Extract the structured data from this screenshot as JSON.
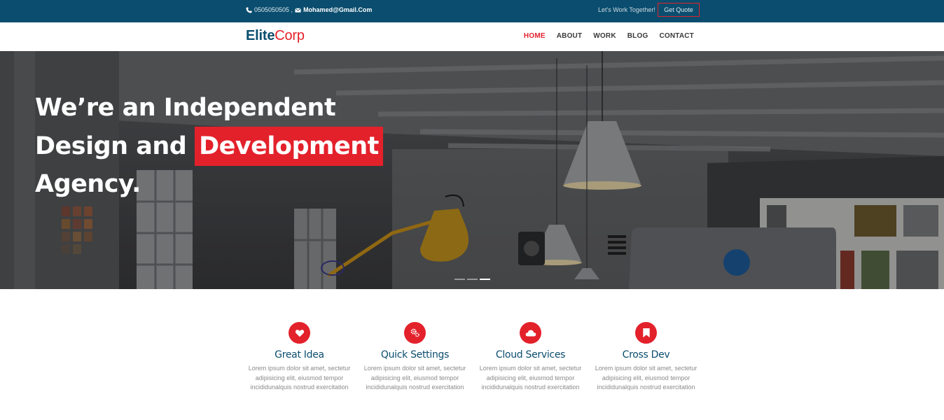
{
  "topbar": {
    "phone": "0505050505 ,",
    "email": "Mohamed@Gmail.Com",
    "tagline": "Let's Work Together!",
    "quote_label": "Get Quote"
  },
  "logo": {
    "part1": "Elite",
    "part2": "Corp"
  },
  "nav": {
    "items": [
      "HOME",
      "ABOUT",
      "WORK",
      "BLOG",
      "CONTACT"
    ],
    "active": "HOME"
  },
  "hero": {
    "line1": "We’re an Independent",
    "line2_pre": "Design and",
    "line2_highlight": "Development",
    "line3": "Agency.",
    "slides": 3,
    "active_slide": 3
  },
  "features": [
    {
      "icon": "heart-icon",
      "title": "Great Idea",
      "text": "Lorem ipsum dolor sit amet, sectetur adipisicing elit, eiusmod tempor incididunalquis nostrud exercitation"
    },
    {
      "icon": "gears-icon",
      "title": "Quick Settings",
      "text": "Lorem ipsum dolor sit amet, sectetur adipisicing elit, eiusmod tempor incididunalquis nostrud exercitation"
    },
    {
      "icon": "cloud-icon",
      "title": "Cloud Services",
      "text": "Lorem ipsum dolor sit amet, sectetur adipisicing elit, eiusmod tempor incididunalquis nostrud exercitation"
    },
    {
      "icon": "bookmark-icon",
      "title": "Cross Dev",
      "text": "Lorem ipsum dolor sit amet, sectetur adipisicing elit, eiusmod tempor incididunalquis nostrud exercitation"
    }
  ],
  "colors": {
    "brand": "#0a4d6e",
    "accent": "#e3212b"
  }
}
